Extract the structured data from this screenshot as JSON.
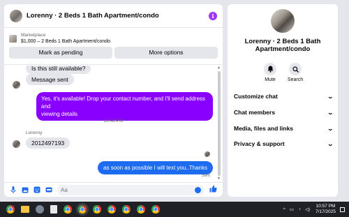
{
  "header": {
    "title": "Lorenny · 2 Beds 1 Bath Apartment/condo"
  },
  "listing": {
    "label": "Marketplace",
    "description": "$1,000 – 2 Beds 1 Bath Apartment/condo",
    "mark_pending": "Mark as pending",
    "more_options": "More options"
  },
  "messages": {
    "in1": "Is this still available?",
    "in2": "Message sent",
    "out1_line1": "Yes, it's available! Drop your contact number, and I'll send address and",
    "out1_line2": "viewing details",
    "timestamp": "10:48 PM",
    "sender": "Lorenny",
    "in3": "2012497193",
    "out2": "as soon as possible I will text you..Thanks",
    "status": "Sent"
  },
  "composer": {
    "placeholder": "Aa"
  },
  "info": {
    "name_line1": "Lorenny · 2 Beds 1 Bath",
    "name_line2": "Apartment/condo",
    "mute": "Mute",
    "search": "Search",
    "sections": [
      "Customize chat",
      "Chat members",
      "Media, files and links",
      "Privacy & support"
    ]
  },
  "taskbar": {
    "time": "10:57 PM",
    "date": "7/17/2025"
  },
  "colors": {
    "accent_purple": "#8a00ff",
    "accent_blue": "#1d6bf0"
  }
}
